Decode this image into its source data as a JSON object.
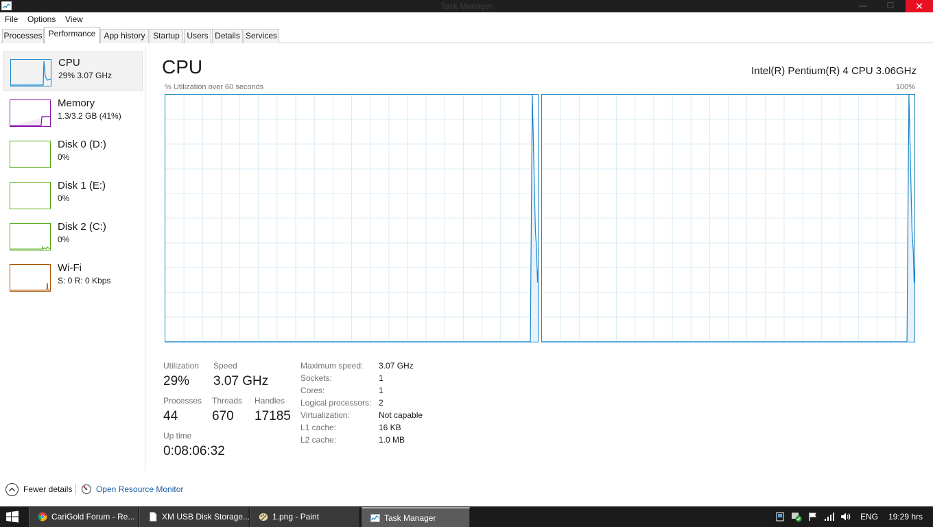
{
  "window": {
    "title": "Task Manager",
    "close": "✕",
    "minimize": "—",
    "maximize": "☐"
  },
  "menu": [
    "File",
    "Options",
    "View"
  ],
  "tabs": [
    "Processes",
    "Performance",
    "App history",
    "Startup",
    "Users",
    "Details",
    "Services"
  ],
  "sidebar": [
    {
      "name": "CPU",
      "sub": "29%  3.07 GHz",
      "color": "#1a86c8"
    },
    {
      "name": "Memory",
      "sub": "1.3/3.2 GB (41%)",
      "color": "#8b12ae"
    },
    {
      "name": "Disk 0 (D:)",
      "sub": "0%",
      "color": "#4da60c"
    },
    {
      "name": "Disk 1 (E:)",
      "sub": "0%",
      "color": "#4da60c"
    },
    {
      "name": "Disk 2 (C:)",
      "sub": "0%",
      "color": "#4da60c"
    },
    {
      "name": "Wi-Fi",
      "sub": "S: 0  R: 0 Kbps",
      "color": "#a74f01"
    }
  ],
  "main": {
    "title": "CPU",
    "processor": "Intel(R) Pentium(R) 4 CPU 3.06GHz",
    "graph_caption": "% Utilization over 60 seconds",
    "graph_max": "100%",
    "stats": {
      "utilization_label": "Utilization",
      "utilization": "29%",
      "speed_label": "Speed",
      "speed": "3.07 GHz",
      "processes_label": "Processes",
      "processes": "44",
      "threads_label": "Threads",
      "threads": "670",
      "handles_label": "Handles",
      "handles": "17185",
      "uptime_label": "Up time",
      "uptime": "0:08:06:32"
    },
    "details": [
      {
        "label": "Maximum speed:",
        "value": "3.07 GHz"
      },
      {
        "label": "Sockets:",
        "value": "1"
      },
      {
        "label": "Cores:",
        "value": "1"
      },
      {
        "label": "Logical processors:",
        "value": "2"
      },
      {
        "label": "Virtualization:",
        "value": "Not capable"
      },
      {
        "label": "L1 cache:",
        "value": "16 KB"
      },
      {
        "label": "L2 cache:",
        "value": "1.0 MB"
      }
    ]
  },
  "chart_data": [
    {
      "type": "area",
      "xlim": [
        60,
        0
      ],
      "ylim": [
        0,
        100
      ],
      "grid": true,
      "x": [
        60,
        1.2,
        0.9,
        0.4,
        0.2,
        0.05,
        0
      ],
      "values": [
        0,
        0,
        100,
        45,
        37,
        24,
        29
      ],
      "color": "#1a86c8"
    }
  ],
  "footer": {
    "fewer_details": "Fewer details",
    "resource_monitor": "Open Resource Monitor"
  },
  "taskbar": {
    "tasks": [
      "CariGold Forum - Re...",
      "XM USB Disk Storage...",
      "1.png - Paint",
      "Task Manager"
    ],
    "active_task": "Task Manager",
    "language": "ENG",
    "clock": "19:29 hrs"
  }
}
